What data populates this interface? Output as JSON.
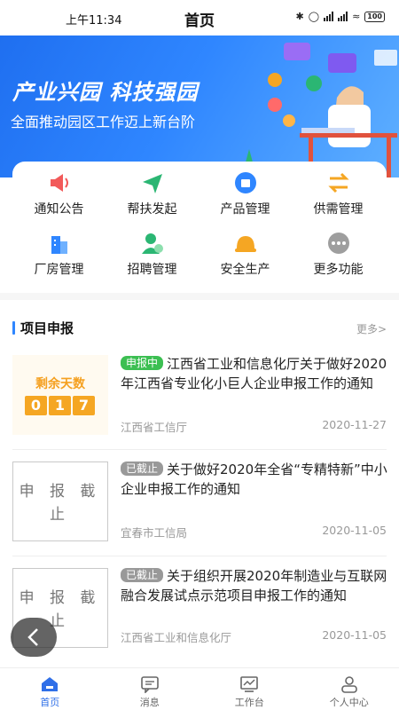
{
  "status_bar": {
    "time": "上午11:34",
    "title": "首页",
    "battery": "100"
  },
  "banner": {
    "title": "产业兴园  科技强园",
    "subtitle": "全面推动园区工作迈上新台阶"
  },
  "menu": {
    "items": [
      {
        "label": "通知公告",
        "icon": "megaphone-icon",
        "color": "#f25a5a"
      },
      {
        "label": "帮扶发起",
        "icon": "send-icon",
        "color": "#2bb673"
      },
      {
        "label": "产品管理",
        "icon": "product-icon",
        "color": "#2f86ff"
      },
      {
        "label": "供需管理",
        "icon": "exchange-icon",
        "color": "#f5a623"
      },
      {
        "label": "厂房管理",
        "icon": "building-icon",
        "color": "#2f86ff"
      },
      {
        "label": "招聘管理",
        "icon": "recruit-icon",
        "color": "#2bb673"
      },
      {
        "label": "安全生产",
        "icon": "helmet-icon",
        "color": "#f5a623"
      },
      {
        "label": "更多功能",
        "icon": "more-icon",
        "color": "#9e9e9e"
      }
    ]
  },
  "section": {
    "title": "项目申报",
    "more": "更多>"
  },
  "projects": [
    {
      "thumb_label": "剩余天数",
      "digits": [
        "0",
        "1",
        "7"
      ],
      "tag": "申报中",
      "title": "江西省工业和信息化厅关于做好2020年江西省专业化小巨人企业申报工作的通知",
      "source": "江西省工信厅",
      "date": "2020-11-27"
    },
    {
      "thumb_text": "申 报 截 止",
      "tag": "已截止",
      "title": "关于做好2020年全省“专精特新”中小企业申报工作的通知",
      "source": "宜春市工信局",
      "date": "2020-11-05"
    },
    {
      "thumb_text": "申 报 截 止",
      "tag": "已截止",
      "title": "关于组织开展2020年制造业与互联网融合发展试点示范项目申报工作的通知",
      "source": "江西省工业和信息化厅",
      "date": "2020-11-05"
    }
  ],
  "tabbar": {
    "tabs": [
      {
        "label": "首页",
        "icon": "home-icon",
        "active": true
      },
      {
        "label": "消息",
        "icon": "message-icon",
        "active": false
      },
      {
        "label": "工作台",
        "icon": "workbench-icon",
        "active": false
      },
      {
        "label": "个人中心",
        "icon": "profile-icon",
        "active": false
      }
    ]
  },
  "colors": {
    "primary": "#2f86ff",
    "active_tag": "#3cbf52",
    "ended_tag": "#999999",
    "countdown": "#f5a623"
  }
}
